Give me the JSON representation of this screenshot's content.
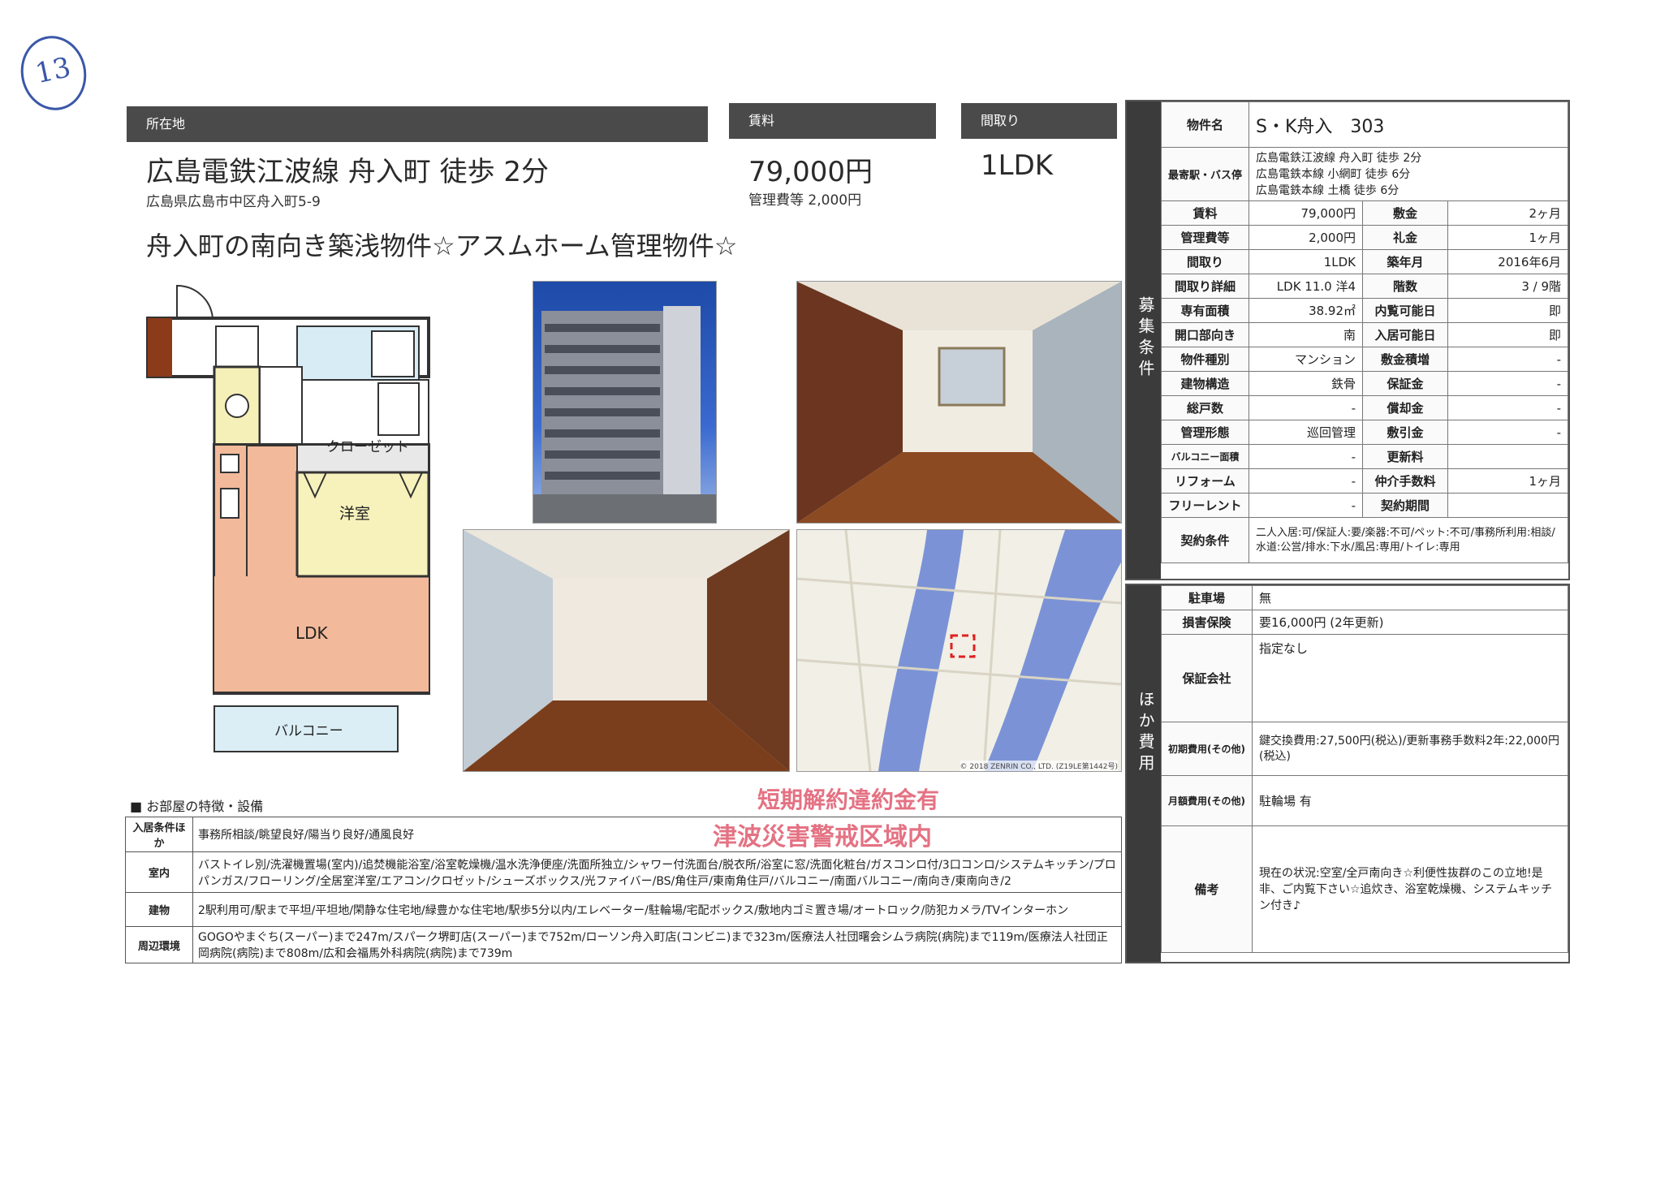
{
  "page_number": "13",
  "location": {
    "header": "所在地",
    "main": "広島電鉄江波線 舟入町 徒歩 2分",
    "address": "広島県広島市中区舟入町5-9"
  },
  "rent": {
    "header": "賃料",
    "amount": "79,000円",
    "fee": "管理費等 2,000円"
  },
  "layout": {
    "header": "間取り",
    "value": "1LDK"
  },
  "catchcopy": "舟入町の南向き築浅物件☆アスムホーム管理物件☆",
  "floorplan_labels": {
    "closet": "クローゼット",
    "western": "洋室",
    "ldk": "LDK",
    "balcony": "バルコニー"
  },
  "map_credit": "© 2018 ZENRIN CO., LTD. (Z19LE第1442号)",
  "stamps": {
    "line1": "短期解約違約金有",
    "line2": "津波災害警戒区域内"
  },
  "features": {
    "title": "■ お部屋の特徴・設備",
    "rows": [
      {
        "key": "入居条件ほか",
        "value": "事務所相談/眺望良好/陽当り良好/通風良好"
      },
      {
        "key": "室内",
        "value": "バストイレ別/洗濯機置場(室内)/追焚機能浴室/浴室乾燥機/温水洗浄便座/洗面所独立/シャワー付洗面台/脱衣所/浴室に窓/洗面化粧台/ガスコンロ付/3口コンロ/システムキッチン/プロパンガス/フローリング/全居室洋室/エアコン/クロゼット/シューズボックス/光ファイバー/BS/角住戸/東南角住戸/バルコニー/南面バルコニー/南向き/東南向き/2"
      },
      {
        "key": "建物",
        "value": "2駅利用可/駅まで平坦/平坦地/閑静な住宅地/緑豊かな住宅地/駅歩5分以内/エレベーター/駐輪場/宅配ボックス/敷地内ゴミ置き場/オートロック/防犯カメラ/TVインターホン"
      },
      {
        "key": "周辺環境",
        "value": "GOGOやまぐち(スーパー)まで247m/スパーク堺町店(スーパー)まで752m/ローソン舟入町店(コンビニ)まで323m/医療法人社団曙会シムラ病院(病院)まで119m/医療法人社団正岡病院(病院)まで808m/広和会福馬外科病院(病院)まで739m"
      }
    ]
  },
  "spec": {
    "band1": "募集条件",
    "band2": "ほか費用",
    "name_key": "物件名",
    "name_value": "S・K舟入　303",
    "station_key": "最寄駅・バス停",
    "stations": [
      "広島電鉄江波線 舟入町 徒歩 2分",
      "広島電鉄本線 小網町 徒歩 6分",
      "広島電鉄本線 土橋 徒歩 6分"
    ],
    "rows": [
      {
        "k1": "賃料",
        "v1": "79,000円",
        "k2": "敷金",
        "v2": "2ヶ月"
      },
      {
        "k1": "管理費等",
        "v1": "2,000円",
        "k2": "礼金",
        "v2": "1ヶ月"
      },
      {
        "k1": "間取り",
        "v1": "1LDK",
        "k2": "築年月",
        "v2": "2016年6月"
      },
      {
        "k1": "間取り詳細",
        "v1": "LDK 11.0 洋4",
        "k2": "階数",
        "v2": "3 / 9階"
      },
      {
        "k1": "専有面積",
        "v1": "38.92㎡",
        "k2": "内覧可能日",
        "v2": "即"
      },
      {
        "k1": "開口部向き",
        "v1": "南",
        "k2": "入居可能日",
        "v2": "即"
      },
      {
        "k1": "物件種別",
        "v1": "マンション",
        "k2": "敷金積増",
        "v2": "-"
      },
      {
        "k1": "建物構造",
        "v1": "鉄骨",
        "k2": "保証金",
        "v2": "-"
      },
      {
        "k1": "総戸数",
        "v1": "-",
        "k2": "償却金",
        "v2": "-"
      },
      {
        "k1": "管理形態",
        "v1": "巡回管理",
        "k2": "敷引金",
        "v2": "-"
      },
      {
        "k1": "バルコニー面積",
        "v1": "-",
        "k2": "更新料",
        "v2": ""
      },
      {
        "k1": "リフォーム",
        "v1": "-",
        "k2": "仲介手数料",
        "v2": "1ヶ月"
      },
      {
        "k1": "フリーレント",
        "v1": "-",
        "k2": "契約期間",
        "v2": ""
      }
    ],
    "contract_key": "契約条件",
    "contract_value": "二人入居:可/保証人:要/楽器:不可/ペット:不可/事務所利用:相談/水道:公営/排水:下水/風呂:専用/トイレ:専用",
    "other": [
      {
        "k": "駐車場",
        "v": "無"
      },
      {
        "k": "損害保険",
        "v": "要16,000円 (2年更新)"
      },
      {
        "k": "保証会社",
        "v": "指定なし"
      },
      {
        "k": "初期費用(その他)",
        "v": "鍵交換費用:27,500円(税込)/更新事務手数料2年:22,000円(税込)"
      },
      {
        "k": "月額費用(その他)",
        "v": "駐輪場 有"
      },
      {
        "k": "備考",
        "v": "現在の状況:空室/全戸南向き☆利便性抜群のこの立地!是非、ご内覧下さい☆追炊き、浴室乾燥機、システムキッチン付き♪"
      }
    ]
  }
}
